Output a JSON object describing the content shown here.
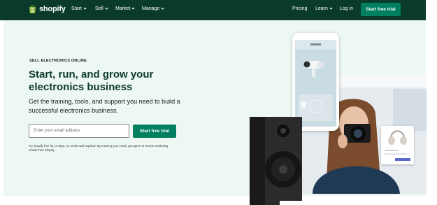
{
  "brand": {
    "name": "shopify"
  },
  "nav": {
    "left_items": [
      {
        "label": "Start"
      },
      {
        "label": "Sell"
      },
      {
        "label": "Market"
      },
      {
        "label": "Manage"
      }
    ],
    "pricing": "Pricing",
    "learn": "Learn",
    "login": "Log in",
    "cta": "Start free trial"
  },
  "hero": {
    "eyebrow": "SELL ELECTRONICS ONLINE",
    "headline": "Start, run, and grow your electronics business",
    "subcopy": "Get the training, tools, and support you need to build a successful electronics business.",
    "email_placeholder": "Enter your email address",
    "cta": "Start free trial",
    "disclaimer": "Try Shopify free for 14 days, no credit card required. By entering your email, you agree to receive marketing emails from Shopify."
  },
  "colors": {
    "nav_bg": "#0a3a2a",
    "hero_bg": "#eef8f2",
    "accent": "#008060",
    "headline": "#0b3a2a"
  },
  "icons": [
    "shopping-bag-icon",
    "chevron-down-icon"
  ]
}
